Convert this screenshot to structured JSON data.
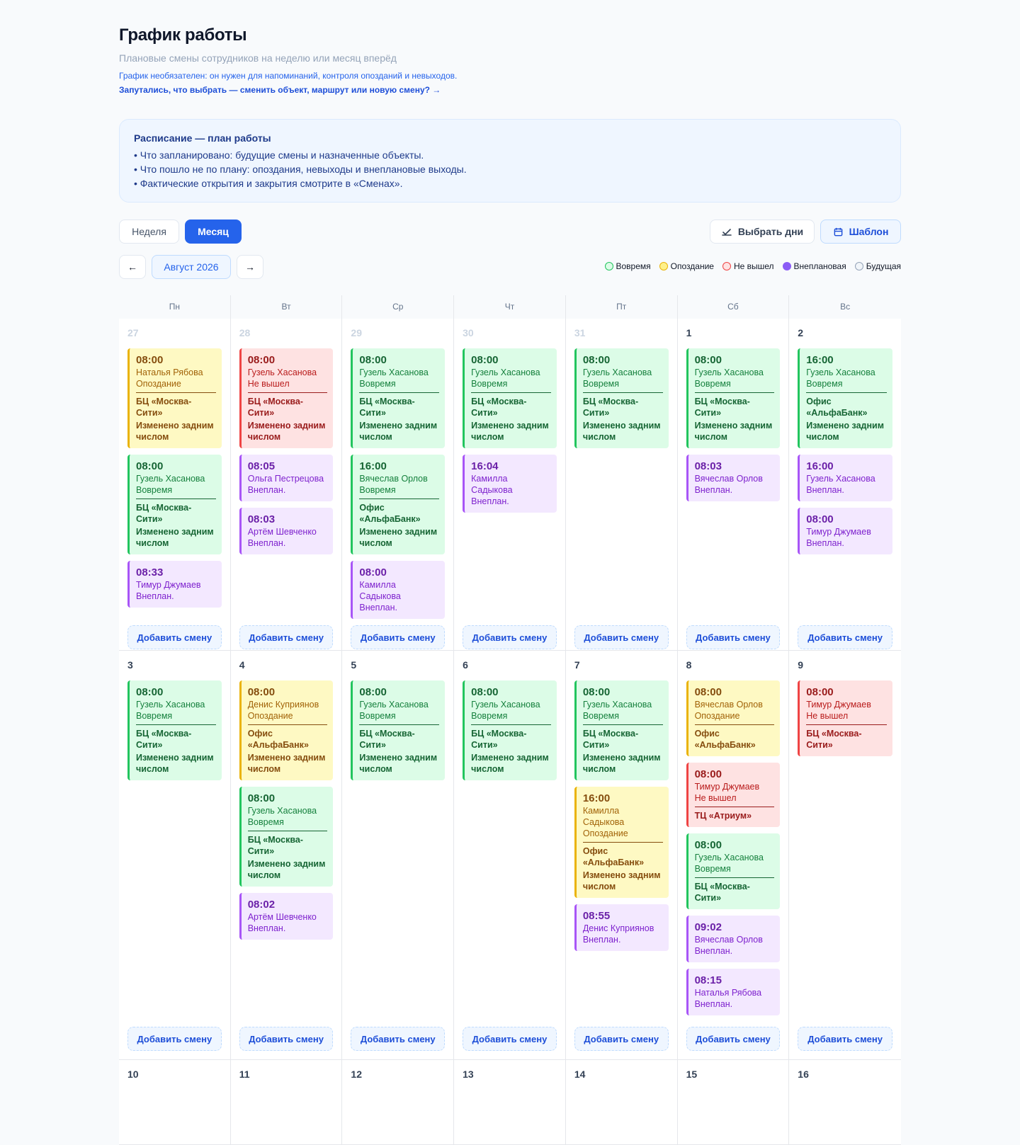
{
  "header": {
    "title": "График работы",
    "subtitle": "Плановые смены сотрудников на неделю или месяц вперёд",
    "note": "График необязателен: он нужен для напоминаний, контроля опозданий и невыходов.",
    "help_link": "Запутались, что выбрать — сменить объект, маршрут или новую смену? →"
  },
  "info": {
    "title": "Расписание — план работы",
    "lines": [
      "• Что запланировано: будущие смены и назначенные объекты.",
      "• Что пошло не по плану: опоздания, невыходы и внеплановые выходы.",
      "• Фактические открытия и закрытия смотрите в «Сменах»."
    ]
  },
  "toolbar": {
    "week_label": "Неделя",
    "month_label": "Месяц",
    "pick_days_label": "Выбрать дни",
    "template_label": "Шаблон",
    "prev_label": "←",
    "next_label": "→",
    "period_label": "Август 2026"
  },
  "legend": [
    {
      "label": "Вовремя",
      "fill": "#dcfce7",
      "border": "#22c55e"
    },
    {
      "label": "Опоздание",
      "fill": "#fef08a",
      "border": "#eab308"
    },
    {
      "label": "Не вышел",
      "fill": "#fee2e2",
      "border": "#ef4444"
    },
    {
      "label": "Внеплановая",
      "fill": "#8b5cf6",
      "border": "#8b5cf6"
    },
    {
      "label": "Будущая",
      "fill": "#f1f5f9",
      "border": "#94a3b8"
    }
  ],
  "calendar": {
    "weekdays": [
      "Пн",
      "Вт",
      "Ср",
      "Чт",
      "Пт",
      "Сб",
      "Вс"
    ],
    "add_label": "Добавить смену",
    "weeks": [
      {
        "height": 469,
        "days": [
          {
            "num": "27",
            "other": true,
            "shifts": [
              {
                "kind": "yellow",
                "time": "08:00",
                "name": "Наталья Рябова",
                "status": "Опоздание",
                "loc": "БЦ «Москва-Сити»",
                "changed": "Изменено задним числом"
              },
              {
                "kind": "green",
                "time": "08:00",
                "name": "Гузель Хасанова",
                "status": "Вовремя",
                "loc": "БЦ «Москва-Сити»",
                "changed": "Изменено задним числом"
              },
              {
                "kind": "purple",
                "time": "08:33",
                "name": "Тимур Джумаев",
                "status": "Внеплан."
              }
            ]
          },
          {
            "num": "28",
            "other": true,
            "shifts": [
              {
                "kind": "red",
                "time": "08:00",
                "name": "Гузель Хасанова",
                "status": "Не вышел",
                "loc": "БЦ «Москва-Сити»",
                "changed": "Изменено задним числом"
              },
              {
                "kind": "purple",
                "time": "08:05",
                "name": "Ольга Пестрецова",
                "status": "Внеплан."
              },
              {
                "kind": "purple",
                "time": "08:03",
                "name": "Артём Шевченко",
                "status": "Внеплан."
              }
            ]
          },
          {
            "num": "29",
            "other": true,
            "shifts": [
              {
                "kind": "green",
                "time": "08:00",
                "name": "Гузель Хасанова",
                "status": "Вовремя",
                "loc": "БЦ «Москва-Сити»",
                "changed": "Изменено задним числом"
              },
              {
                "kind": "green",
                "time": "16:00",
                "name": "Вячеслав Орлов",
                "status": "Вовремя",
                "loc": "Офис «АльфаБанк»",
                "changed": "Изменено задним числом"
              },
              {
                "kind": "purple",
                "time": "08:00",
                "name": "Камилла Садыкова",
                "status": "Внеплан."
              }
            ]
          },
          {
            "num": "30",
            "other": true,
            "shifts": [
              {
                "kind": "green",
                "time": "08:00",
                "name": "Гузель Хасанова",
                "status": "Вовремя",
                "loc": "БЦ «Москва-Сити»",
                "changed": "Изменено задним числом"
              },
              {
                "kind": "purple",
                "time": "16:04",
                "name": "Камилла Садыкова",
                "status": "Внеплан."
              }
            ]
          },
          {
            "num": "31",
            "other": true,
            "shifts": [
              {
                "kind": "green",
                "time": "08:00",
                "name": "Гузель Хасанова",
                "status": "Вовремя",
                "loc": "БЦ «Москва-Сити»",
                "changed": "Изменено задним числом"
              }
            ]
          },
          {
            "num": "1",
            "other": false,
            "shifts": [
              {
                "kind": "green",
                "time": "08:00",
                "name": "Гузель Хасанова",
                "status": "Вовремя",
                "loc": "БЦ «Москва-Сити»",
                "changed": "Изменено задним числом"
              },
              {
                "kind": "purple",
                "time": "08:03",
                "name": "Вячеслав Орлов",
                "status": "Внеплан."
              }
            ]
          },
          {
            "num": "2",
            "other": false,
            "shifts": [
              {
                "kind": "green",
                "time": "16:00",
                "name": "Гузель Хасанова",
                "status": "Вовремя",
                "loc": "Офис «АльфаБанк»",
                "changed": "Изменено задним числом"
              },
              {
                "kind": "purple",
                "time": "16:00",
                "name": "Гузель Хасанова",
                "status": "Внеплан."
              },
              {
                "kind": "purple",
                "time": "08:00",
                "name": "Тимур Джумаев",
                "status": "Внеплан."
              }
            ]
          }
        ]
      },
      {
        "height": 578,
        "days": [
          {
            "num": "3",
            "other": false,
            "shifts": [
              {
                "kind": "green",
                "time": "08:00",
                "name": "Гузель Хасанова",
                "status": "Вовремя",
                "loc": "БЦ «Москва-Сити»",
                "changed": "Изменено задним числом"
              }
            ]
          },
          {
            "num": "4",
            "other": false,
            "shifts": [
              {
                "kind": "yellow",
                "time": "08:00",
                "name": "Денис Куприянов",
                "status": "Опоздание",
                "loc": "Офис «АльфаБанк»",
                "changed": "Изменено задним числом"
              },
              {
                "kind": "green",
                "time": "08:00",
                "name": "Гузель Хасанова",
                "status": "Вовремя",
                "loc": "БЦ «Москва-Сити»",
                "changed": "Изменено задним числом"
              },
              {
                "kind": "purple",
                "time": "08:02",
                "name": "Артём Шевченко",
                "status": "Внеплан."
              }
            ]
          },
          {
            "num": "5",
            "other": false,
            "shifts": [
              {
                "kind": "green",
                "time": "08:00",
                "name": "Гузель Хасанова",
                "status": "Вовремя",
                "loc": "БЦ «Москва-Сити»",
                "changed": "Изменено задним числом"
              }
            ]
          },
          {
            "num": "6",
            "other": false,
            "shifts": [
              {
                "kind": "green",
                "time": "08:00",
                "name": "Гузель Хасанова",
                "status": "Вовремя",
                "loc": "БЦ «Москва-Сити»",
                "changed": "Изменено задним числом"
              }
            ]
          },
          {
            "num": "7",
            "other": false,
            "shifts": [
              {
                "kind": "green",
                "time": "08:00",
                "name": "Гузель Хасанова",
                "status": "Вовремя",
                "loc": "БЦ «Москва-Сити»",
                "changed": "Изменено задним числом"
              },
              {
                "kind": "yellow",
                "time": "16:00",
                "name": "Камилла Садыкова",
                "status": "Опоздание",
                "loc": "Офис «АльфаБанк»",
                "changed": "Изменено задним числом"
              },
              {
                "kind": "purple",
                "time": "08:55",
                "name": "Денис Куприянов",
                "status": "Внеплан."
              }
            ]
          },
          {
            "num": "8",
            "other": false,
            "shifts": [
              {
                "kind": "yellow",
                "time": "08:00",
                "name": "Вячеслав Орлов",
                "status": "Опоздание",
                "loc": "Офис «АльфаБанк»"
              },
              {
                "kind": "red",
                "time": "08:00",
                "name": "Тимур Джумаев",
                "status": "Не вышел",
                "loc": "ТЦ «Атриум»"
              },
              {
                "kind": "green",
                "time": "08:00",
                "name": "Гузель Хасанова",
                "status": "Вовремя",
                "loc": "БЦ «Москва-Сити»"
              },
              {
                "kind": "purple",
                "time": "09:02",
                "name": "Вячеслав Орлов",
                "status": "Внеплан."
              },
              {
                "kind": "purple",
                "time": "08:15",
                "name": "Наталья Рябова",
                "status": "Внеплан."
              }
            ]
          },
          {
            "num": "9",
            "other": false,
            "shifts": [
              {
                "kind": "red",
                "time": "08:00",
                "name": "Тимур Джумаев",
                "status": "Не вышел",
                "loc": "БЦ «Москва-Сити»"
              }
            ]
          }
        ]
      },
      {
        "height": 120,
        "days": [
          {
            "num": "10",
            "other": false,
            "shifts": []
          },
          {
            "num": "11",
            "other": false,
            "shifts": []
          },
          {
            "num": "12",
            "other": false,
            "shifts": []
          },
          {
            "num": "13",
            "other": false,
            "shifts": []
          },
          {
            "num": "14",
            "other": false,
            "shifts": []
          },
          {
            "num": "15",
            "other": false,
            "shifts": []
          },
          {
            "num": "16",
            "other": false,
            "shifts": []
          }
        ],
        "no_add": true
      }
    ]
  }
}
